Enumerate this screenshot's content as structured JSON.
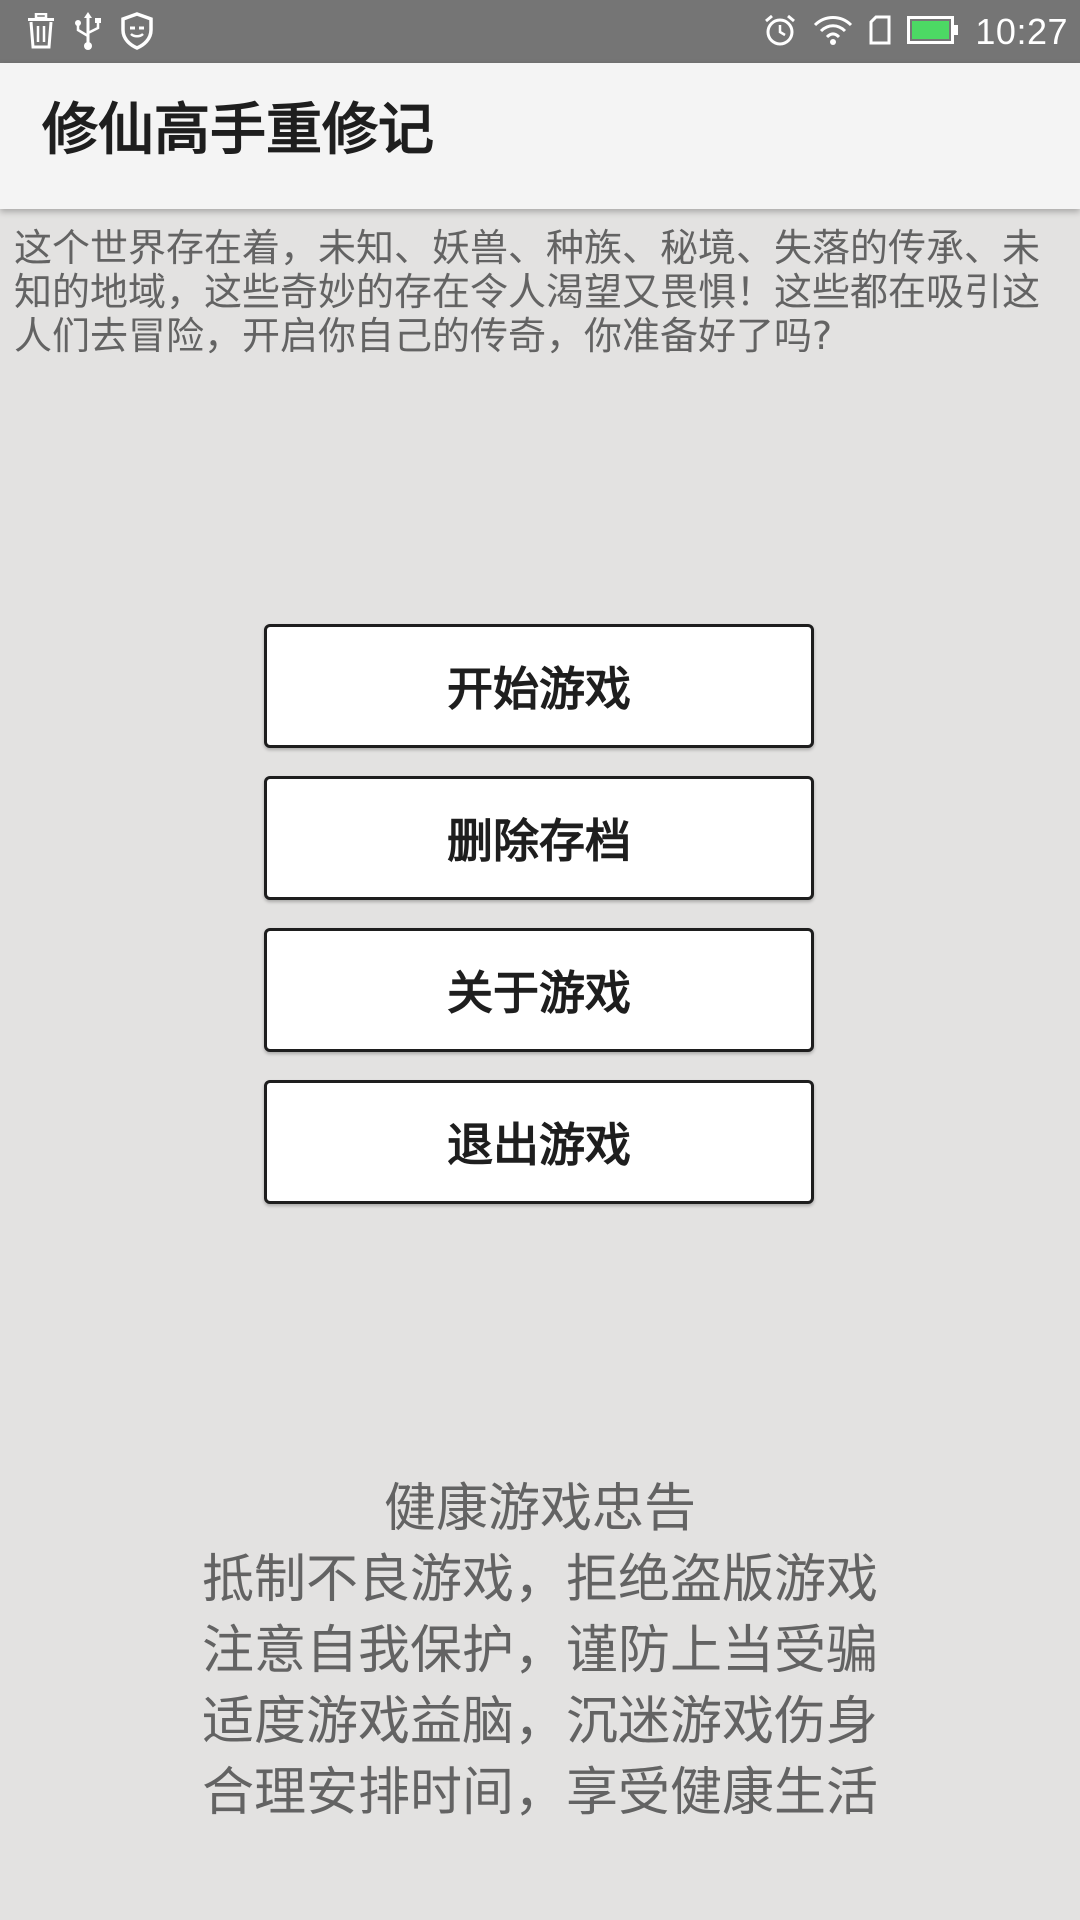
{
  "status_bar": {
    "left_icons": [
      "trash-icon",
      "usb-icon",
      "shield-icon"
    ],
    "right_icons": [
      "alarm-icon",
      "wifi-icon",
      "sim-card-icon",
      "battery-icon"
    ],
    "time": "10:27",
    "battery_color": "#4cd964"
  },
  "app_bar": {
    "title": "修仙高手重修记"
  },
  "intro": {
    "text": "这个世界存在着，未知、妖兽、种族、秘境、失落的传承、未知的地域，这些奇妙的存在令人渴望又畏惧！这些都在吸引这人们去冒险，开启你自己的传奇，你准备好了吗?"
  },
  "menu": {
    "buttons": [
      {
        "label": "开始游戏"
      },
      {
        "label": "删除存档"
      },
      {
        "label": "关于游戏"
      },
      {
        "label": "退出游戏"
      }
    ]
  },
  "health_notice": {
    "title": "健康游戏忠告",
    "lines": [
      "抵制不良游戏，拒绝盗版游戏",
      "注意自我保护，谨防上当受骗",
      "适度游戏益脑，沉迷游戏伤身",
      "合理安排时间，享受健康生活"
    ]
  },
  "colors": {
    "status_bar_bg": "#757575",
    "app_bar_bg": "#f4f4f4",
    "page_bg": "#e3e2e1",
    "text_gray": "#636363",
    "button_bg": "#ffffff",
    "button_border": "#1e1e1e"
  }
}
